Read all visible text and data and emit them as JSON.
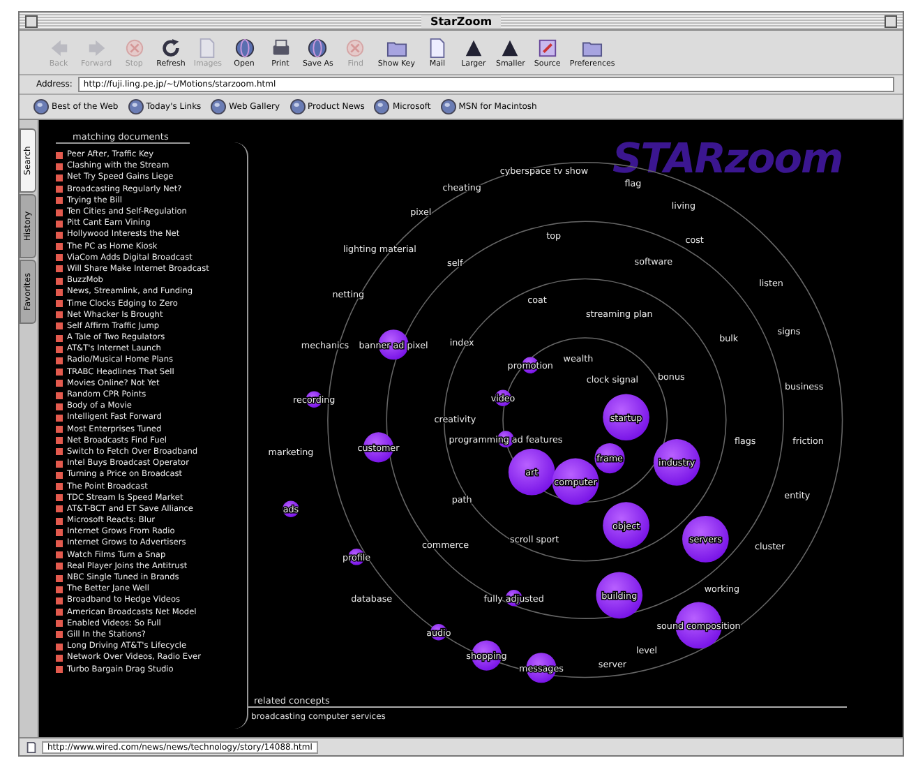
{
  "window": {
    "title": "StarZoom"
  },
  "toolbar": [
    {
      "label": "Back",
      "disabled": true
    },
    {
      "label": "Forward",
      "disabled": true
    },
    {
      "label": "Stop",
      "disabled": true
    },
    {
      "label": "Refresh",
      "disabled": false
    },
    {
      "label": "Images",
      "disabled": true
    },
    {
      "label": "Open",
      "disabled": false
    },
    {
      "label": "Print",
      "disabled": false
    },
    {
      "label": "Save As",
      "disabled": false
    },
    {
      "label": "Find",
      "disabled": true
    },
    {
      "label": "Show Key",
      "disabled": false
    },
    {
      "label": "Mail",
      "disabled": false
    },
    {
      "label": "Larger",
      "disabled": false
    },
    {
      "label": "Smaller",
      "disabled": false
    },
    {
      "label": "Source",
      "disabled": false
    },
    {
      "label": "Preferences",
      "disabled": false
    }
  ],
  "address": {
    "label": "Address:",
    "value": "http://fuji.ling.pe.jp/~t/Motions/starzoom.html"
  },
  "favorites": [
    "Best of the Web",
    "Today's Links",
    "Web Gallery",
    "Product News",
    "Microsoft",
    "MSN for Macintosh"
  ],
  "side_tabs": [
    {
      "label": "Search",
      "selected": true
    },
    {
      "label": "History",
      "selected": false
    },
    {
      "label": "Favorites",
      "selected": false
    }
  ],
  "documents": {
    "title": "matching documents",
    "items": [
      "Peer After, Traffic Key",
      "Clashing with the Stream",
      "Net Try Speed Gains Liege",
      "Broadcasting Regularly Net?",
      "Trying the Bill",
      "Ten Cities and Self-Regulation",
      "Pitt Cant Earn Vining",
      "Hollywood Interests the Net",
      "The PC as Home Kiosk",
      "ViaCom Adds Digital Broadcast",
      "Will Share Make Internet Broadcast",
      "BuzzMob",
      "News, Streamlink, and Funding",
      "Time Clocks Edging to Zero",
      "Net Whacker Is Brought",
      "Self Affirm Traffic Jump",
      "A Tale of Two Regulators",
      "AT&T's Internet Launch",
      "Radio/Musical Home Plans",
      "TRABC Headlines That Sell",
      "Movies Online? Not Yet",
      "Random CPR Points",
      "Body of a Movie",
      "Intelligent Fast Forward",
      "Most Enterprises Tuned",
      "Net Broadcasts Find Fuel",
      "Switch to Fetch Over Broadband",
      "Intel Buys Broadcast Operator",
      "Turning a Price on Broadcast",
      "The Point Broadcast",
      "TDC Stream Is Speed Market",
      "AT&T-BCT and ET Save Alliance",
      "Microsoft Reacts: Blur",
      "Internet Grows From Radio",
      "Internet Grows to Advertisers",
      "Watch Films Turn a Snap",
      "Real Player Joins the Antitrust",
      "NBC Single Tuned in Brands",
      "The Better Jane Well",
      "Broadband to Hedge Videos",
      "American Broadcasts Net Model",
      "Enabled Videos: So Full",
      "Gill In the Stations?",
      "Long Driving AT&T's Lifecycle",
      "Network Over Videos, Radio Ever",
      "Turbo Bargain Drag Studio"
    ]
  },
  "starzoom": {
    "logo": "STARzoom",
    "nodes": [
      {
        "label": "cyberspace tv show",
        "kind": "term"
      },
      {
        "label": "cheating",
        "kind": "term"
      },
      {
        "label": "flag",
        "kind": "term"
      },
      {
        "label": "pixel",
        "kind": "term"
      },
      {
        "label": "living",
        "kind": "term"
      },
      {
        "label": "lighting material",
        "kind": "term"
      },
      {
        "label": "cost",
        "kind": "term"
      },
      {
        "label": "top",
        "kind": "term"
      },
      {
        "label": "self",
        "kind": "term"
      },
      {
        "label": "software",
        "kind": "term"
      },
      {
        "label": "netting",
        "kind": "term"
      },
      {
        "label": "listen",
        "kind": "term"
      },
      {
        "label": "coat",
        "kind": "term"
      },
      {
        "label": "streaming plan",
        "kind": "term"
      },
      {
        "label": "signs",
        "kind": "term"
      },
      {
        "label": "mechanics",
        "kind": "term"
      },
      {
        "label": "banner ad pixel",
        "kind": "medium"
      },
      {
        "label": "index",
        "kind": "term"
      },
      {
        "label": "bulk",
        "kind": "term"
      },
      {
        "label": "promotion",
        "kind": "small"
      },
      {
        "label": "wealth",
        "kind": "term"
      },
      {
        "label": "clock signal",
        "kind": "term"
      },
      {
        "label": "bonus",
        "kind": "term"
      },
      {
        "label": "business",
        "kind": "term"
      },
      {
        "label": "recording",
        "kind": "small"
      },
      {
        "label": "video",
        "kind": "small"
      },
      {
        "label": "startup",
        "kind": "large"
      },
      {
        "label": "creativity",
        "kind": "term"
      },
      {
        "label": "marketing",
        "kind": "term"
      },
      {
        "label": "customer",
        "kind": "medium"
      },
      {
        "label": "programming ad features",
        "kind": "small"
      },
      {
        "label": "flags",
        "kind": "term"
      },
      {
        "label": "friction",
        "kind": "term"
      },
      {
        "label": "art",
        "kind": "large"
      },
      {
        "label": "computer",
        "kind": "large"
      },
      {
        "label": "frame",
        "kind": "medium"
      },
      {
        "label": "industry",
        "kind": "large"
      },
      {
        "label": "entity",
        "kind": "term"
      },
      {
        "label": "ads",
        "kind": "small"
      },
      {
        "label": "path",
        "kind": "term"
      },
      {
        "label": "object",
        "kind": "large"
      },
      {
        "label": "servers",
        "kind": "large"
      },
      {
        "label": "scroll sport",
        "kind": "term"
      },
      {
        "label": "commerce",
        "kind": "term"
      },
      {
        "label": "cluster",
        "kind": "term"
      },
      {
        "label": "profile",
        "kind": "small"
      },
      {
        "label": "working",
        "kind": "term"
      },
      {
        "label": "database",
        "kind": "term"
      },
      {
        "label": "fully adjusted",
        "kind": "small"
      },
      {
        "label": "building",
        "kind": "large"
      },
      {
        "label": "sound composition",
        "kind": "large"
      },
      {
        "label": "audio",
        "kind": "small"
      },
      {
        "label": "shopping",
        "kind": "medium"
      },
      {
        "label": "messages",
        "kind": "medium"
      },
      {
        "label": "level",
        "kind": "term"
      },
      {
        "label": "server",
        "kind": "term"
      }
    ]
  },
  "related": {
    "title": "related concepts",
    "text": "broadcasting computer services"
  },
  "status_bar": {
    "url": "http://www.wired.com/news/news/technology/story/14088.html"
  }
}
